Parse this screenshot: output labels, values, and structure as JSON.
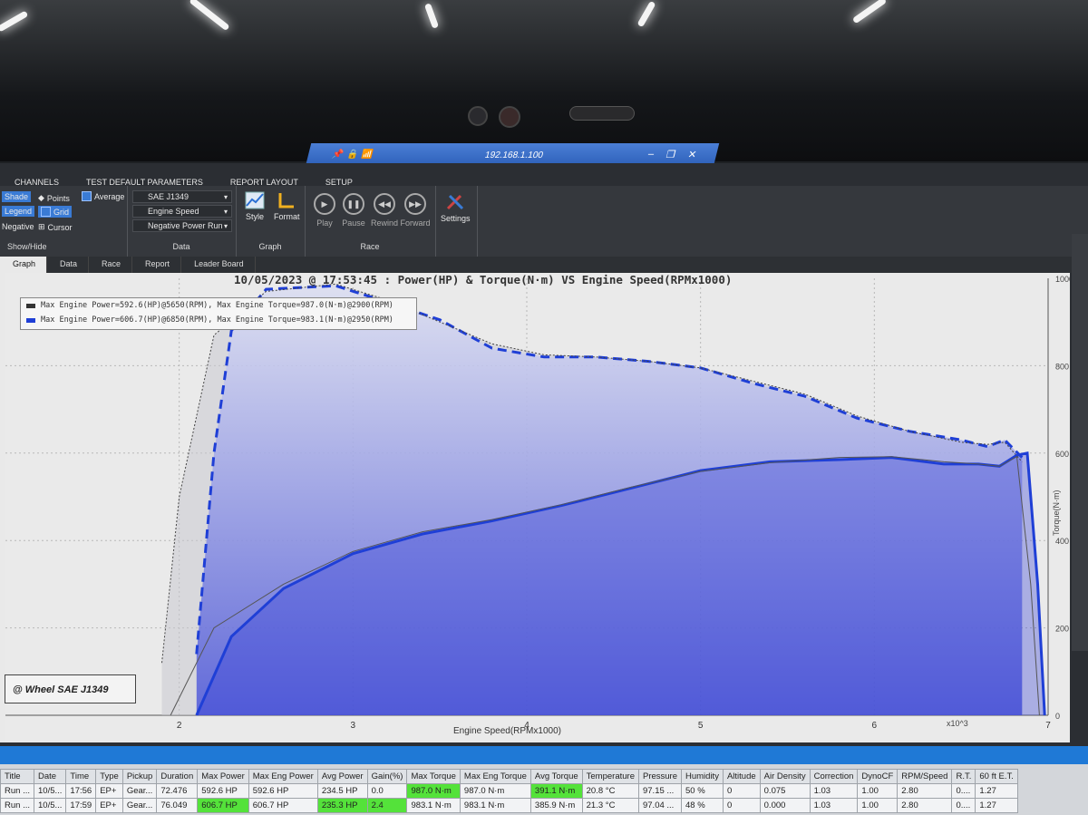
{
  "remote": {
    "ip": "192.168.1.100"
  },
  "menu": [
    "CHANNELS",
    "TEST DEFAULT PARAMETERS",
    "REPORT LAYOUT",
    "SETUP"
  ],
  "ribbon": {
    "showhide": {
      "shade": "Shade",
      "points": "Points",
      "average": "Average",
      "legend": "Legend",
      "grid": "Grid",
      "negative": "Negative",
      "cursor": "Cursor",
      "label": "Show/Hide"
    },
    "data": {
      "standard": "SAE J1349",
      "axis": "Engine Speed",
      "run": "Negative Power Run",
      "label": "Data"
    },
    "graph": {
      "style": "Style",
      "format": "Format",
      "label": "Graph"
    },
    "race": {
      "play": "Play",
      "pause": "Pause",
      "rewind": "Rewind",
      "forward": "Forward",
      "label": "Race"
    },
    "settings": "Settings"
  },
  "tabs": [
    "Graph",
    "Data",
    "Race",
    "Report",
    "Leader Board"
  ],
  "graph_title": "10/05/2023 @ 17:53:45 : Power(HP) & Torque(N·m) VS Engine Speed(RPMx1000)",
  "legend": [
    "Max Engine Power=592.6(HP)@5650(RPM), Max Engine Torque=987.0(N·m)@2900(RPM)",
    "Max Engine Power=606.7(HP)@6850(RPM), Max Engine Torque=983.1(N·m)@2950(RPM)"
  ],
  "wheel_label": "@ Wheel SAE J1349",
  "colors": {
    "run1": "#3a3a3a",
    "run2": "#1f3fd6",
    "highlight": "#54e23a",
    "titlebar": "#1f79d6"
  },
  "chart_data": {
    "type": "line",
    "xlabel": "Engine Speed(RPMx1000)",
    "x_multiplier": "x10^3",
    "ylabel_right": "Torque(N·m)",
    "xlim": [
      1.2,
      7
    ],
    "ylim_right": [
      0,
      1000
    ],
    "x_ticks": [
      "2",
      "3",
      "4",
      "5",
      "6",
      "7"
    ],
    "y_ticks_right": [
      "0",
      "200",
      "400",
      "600",
      "800",
      "1000"
    ],
    "series": [
      {
        "kind": "torque_run2",
        "x": [
          2.1,
          2.2,
          2.3,
          2.5,
          2.9,
          3.2,
          3.5,
          3.8,
          4.1,
          4.4,
          4.7,
          5.0,
          5.3,
          5.6,
          5.9,
          6.2,
          6.5,
          6.65,
          6.75,
          6.85
        ],
        "y": [
          140,
          600,
          880,
          975,
          983,
          945,
          905,
          840,
          820,
          820,
          810,
          795,
          760,
          730,
          680,
          650,
          630,
          615,
          630,
          590
        ]
      },
      {
        "kind": "torque_run1",
        "x": [
          1.9,
          2.0,
          2.2,
          2.5,
          2.9,
          3.2,
          3.5,
          3.8,
          4.1,
          4.4,
          4.7,
          5.0,
          5.3,
          5.6,
          5.9,
          6.2,
          6.5,
          6.65,
          6.75,
          6.85
        ],
        "y": [
          120,
          500,
          870,
          970,
          987,
          950,
          900,
          850,
          825,
          820,
          810,
          795,
          765,
          735,
          685,
          650,
          625,
          620,
          625,
          580
        ]
      },
      {
        "kind": "power_run2",
        "x": [
          2.1,
          2.3,
          2.6,
          3.0,
          3.4,
          3.8,
          4.2,
          4.6,
          5.0,
          5.4,
          5.8,
          6.1,
          6.4,
          6.6,
          6.72,
          6.82,
          6.88,
          6.94,
          6.98
        ],
        "y": [
          0,
          180,
          290,
          370,
          415,
          445,
          480,
          520,
          560,
          580,
          585,
          590,
          575,
          575,
          570,
          595,
          600,
          300,
          0
        ]
      },
      {
        "kind": "power_run1",
        "x": [
          1.95,
          2.2,
          2.6,
          3.0,
          3.4,
          3.8,
          4.2,
          4.6,
          5.0,
          5.4,
          5.8,
          6.1,
          6.4,
          6.6,
          6.72,
          6.82,
          6.9,
          6.95
        ],
        "y": [
          0,
          200,
          300,
          375,
          420,
          448,
          482,
          522,
          558,
          578,
          590,
          592,
          580,
          575,
          570,
          592,
          300,
          0
        ]
      }
    ]
  },
  "table": {
    "headers": [
      "Title",
      "Date",
      "Time",
      "Type",
      "Pickup",
      "Duration",
      "Max Power",
      "Max Eng Power",
      "Avg Power",
      "Gain(%)",
      "Max Torque",
      "Max Eng Torque",
      "Avg Torque",
      "Temperature",
      "Pressure",
      "Humidity",
      "Altitude",
      "Air Density",
      "Correction",
      "DynoCF",
      "RPM/Speed",
      "R.T.",
      "60 ft E.T."
    ],
    "rows": [
      [
        "Run ...",
        "10/5...",
        "17:56",
        "EP+",
        "Gear...",
        "72.476",
        "592.6 HP",
        "592.6 HP",
        "234.5 HP",
        "0.0",
        "987.0 N·m",
        "987.0 N·m",
        "391.1 N·m",
        "20.8 °C",
        "97.15 ...",
        "50 %",
        "0",
        "0.075",
        "1.03",
        "1.00",
        "2.80",
        "0....",
        "1.27"
      ],
      [
        "Run ...",
        "10/5...",
        "17:59",
        "EP+",
        "Gear...",
        "76.049",
        "606.7 HP",
        "606.7 HP",
        "235.3 HP",
        "2.4",
        "983.1 N·m",
        "983.1 N·m",
        "385.9 N·m",
        "21.3 °C",
        "97.04 ...",
        "48 %",
        "0",
        "0.000",
        "1.03",
        "1.00",
        "2.80",
        "0....",
        "1.27"
      ]
    ],
    "highlight": [
      [
        10,
        12
      ],
      [
        6,
        8,
        9
      ]
    ]
  }
}
